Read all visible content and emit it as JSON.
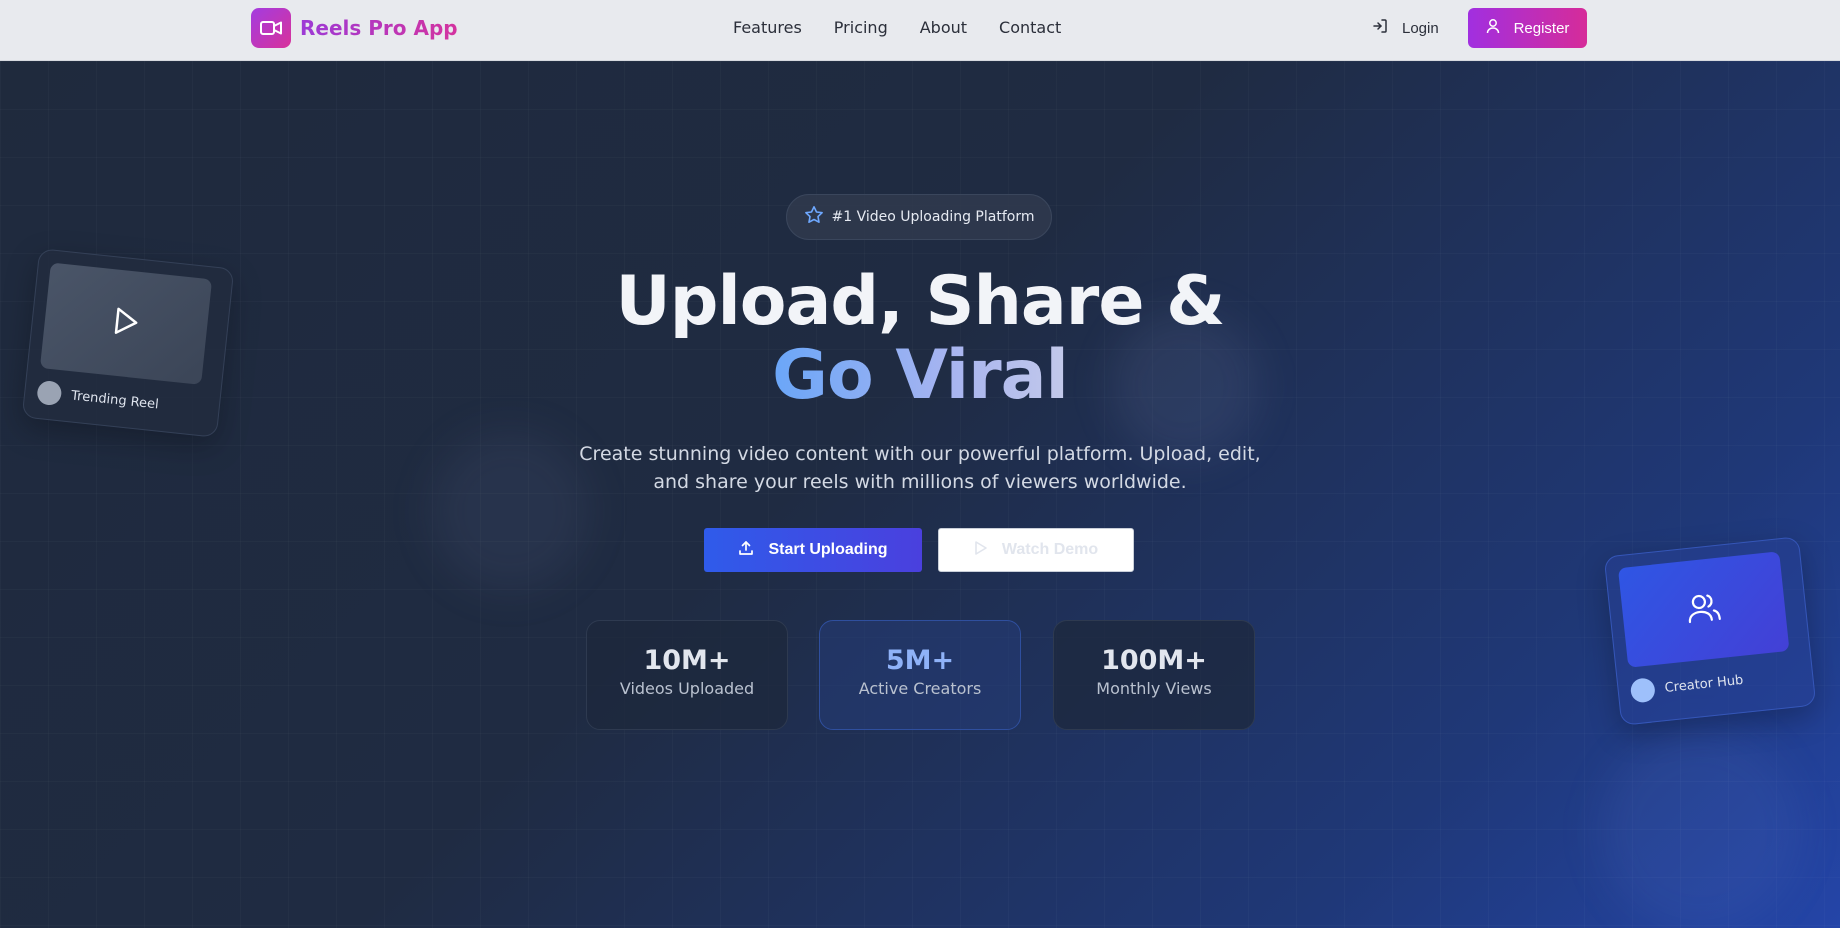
{
  "brand": {
    "name": "Reels Pro App",
    "logo_icon": "video-camera-icon"
  },
  "nav": {
    "links": [
      "Features",
      "Pricing",
      "About",
      "Contact"
    ],
    "login_label": "Login",
    "register_label": "Register"
  },
  "hero": {
    "badge": "#1 Video Uploading Platform",
    "headline_line1": "Upload, Share &",
    "headline_line2": "Go Viral",
    "subtitle_line1": "Create stunning video content with our powerful platform. Upload, edit,",
    "subtitle_line2": "and share your reels with millions of viewers worldwide.",
    "primary_cta": "Start Uploading",
    "secondary_cta": "Watch Demo"
  },
  "stats": [
    {
      "value": "10M+",
      "label": "Videos Uploaded"
    },
    {
      "value": "5M+",
      "label": "Active Creators"
    },
    {
      "value": "100M+",
      "label": "Monthly Views"
    }
  ],
  "floating_cards": {
    "left_label": "Trending Reel",
    "right_label": "Creator Hub"
  },
  "colors": {
    "brand_gradient_start": "#a33ce0",
    "brand_gradient_end": "#d8329a",
    "primary_button": "#2f5bea",
    "accent_text": "#8ab0f8"
  }
}
